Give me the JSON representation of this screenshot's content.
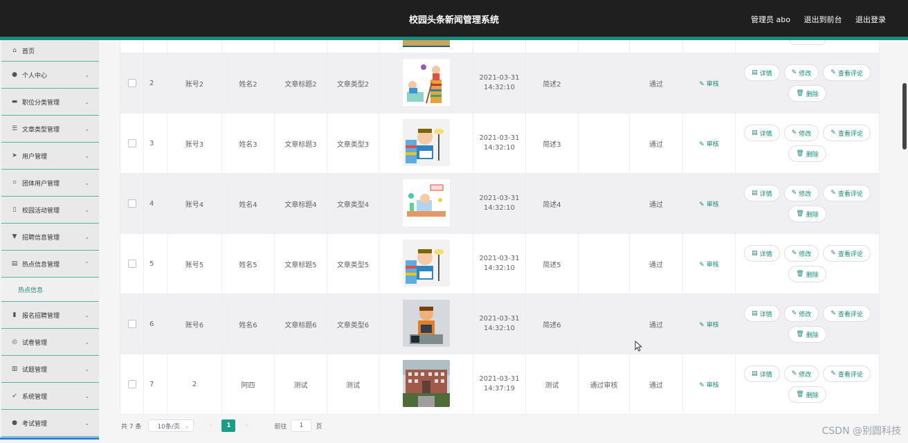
{
  "header": {
    "title": "校园头条新闻管理系统",
    "admin": "管理员 abo",
    "back_front": "退出到前台",
    "logout": "退出登录"
  },
  "sidebar": {
    "items": [
      {
        "label": "首页",
        "icon": "home-icon",
        "glyph": "⌂",
        "chev": ""
      },
      {
        "label": "个人中心",
        "icon": "user-icon",
        "glyph": "●",
        "chev": "⌄"
      },
      {
        "label": "职位分类管理",
        "icon": "monitor-icon",
        "glyph": "▬",
        "chev": "⌄"
      },
      {
        "label": "文章类型管理",
        "icon": "list-icon",
        "glyph": "☰",
        "chev": "⌄"
      },
      {
        "label": "用户管理",
        "icon": "send-icon",
        "glyph": "➤",
        "chev": "⌄"
      },
      {
        "label": "团体用户管理",
        "icon": "crop-icon",
        "glyph": "⌗",
        "chev": "⌄"
      },
      {
        "label": "校园活动管理",
        "icon": "mic-icon",
        "glyph": "▯",
        "chev": "⌄"
      },
      {
        "label": "招聘信息管理",
        "icon": "pin-icon",
        "glyph": "▼",
        "chev": "⌄"
      },
      {
        "label": "热点信息管理",
        "icon": "doc-icon",
        "glyph": "▤",
        "chev": "⌃"
      },
      {
        "label": "报名招聘管理",
        "icon": "chart-icon",
        "glyph": "▮",
        "chev": "⌄"
      },
      {
        "label": "试卷管理",
        "icon": "compass-icon",
        "glyph": "◎",
        "chev": "⌄"
      },
      {
        "label": "试题管理",
        "icon": "bars-icon",
        "glyph": "▥",
        "chev": "⌄"
      },
      {
        "label": "系统管理",
        "icon": "plane-icon",
        "glyph": "➶",
        "chev": "⌄"
      },
      {
        "label": "考试管理",
        "icon": "person-icon",
        "glyph": "●",
        "chev": "⌄"
      }
    ],
    "submenu": "热点信息"
  },
  "table": {
    "rows": [
      {
        "idx": "2",
        "account": "账号2",
        "name": "姓名2",
        "title": "文章标题2",
        "type": "文章类型2",
        "date": "2021-03-31",
        "time": "14:32:10",
        "desc": "简述2",
        "reply": "",
        "status": "通过",
        "img": "kids"
      },
      {
        "idx": "3",
        "account": "账号3",
        "name": "姓名3",
        "title": "文章标题3",
        "type": "文章类型3",
        "date": "2021-03-31",
        "time": "14:32:10",
        "desc": "简述3",
        "reply": "",
        "status": "通过",
        "img": "scholar"
      },
      {
        "idx": "4",
        "account": "账号4",
        "name": "姓名4",
        "title": "文章标题4",
        "type": "文章类型4",
        "date": "2021-03-31",
        "time": "14:32:10",
        "desc": "简述4",
        "reply": "",
        "status": "通过",
        "img": "desk"
      },
      {
        "idx": "5",
        "account": "账号5",
        "name": "姓名5",
        "title": "文章标题5",
        "type": "文章类型5",
        "date": "2021-03-31",
        "time": "14:32:10",
        "desc": "简述5",
        "reply": "",
        "status": "通过",
        "img": "scholar"
      },
      {
        "idx": "6",
        "account": "账号6",
        "name": "姓名6",
        "title": "文章标题6",
        "type": "文章类型6",
        "date": "2021-03-31",
        "time": "14:32:10",
        "desc": "简述6",
        "reply": "",
        "status": "通过",
        "img": "reader"
      },
      {
        "idx": "7",
        "account": "2",
        "name": "阿四",
        "title": "测试",
        "type": "测试",
        "date": "2021-03-31",
        "time": "14:37:19",
        "desc": "测试",
        "reply": "通过审核",
        "status": "通过",
        "img": "building"
      }
    ],
    "audit_label": "审核",
    "btn_detail": "详情",
    "btn_edit": "修改",
    "btn_comments": "查看评论",
    "btn_delete": "删除"
  },
  "pager": {
    "total": "共 7 条",
    "size": "10条/页",
    "page": "1",
    "goto": "前往",
    "goto_value": "1",
    "page_unit": "页"
  },
  "watermark": "CSDN @别圆科技",
  "colors": {
    "accent": "#1a8a7a",
    "header": "#1f1f1f",
    "pager_active": "#1a9e8a"
  }
}
